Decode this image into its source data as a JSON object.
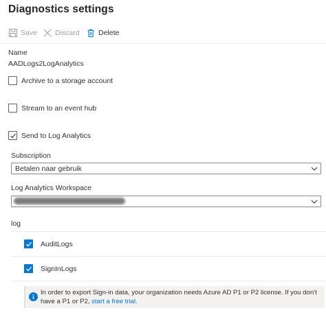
{
  "header": {
    "title": "Diagnostics settings"
  },
  "toolbar": {
    "save_label": "Save",
    "discard_label": "Discard",
    "delete_label": "Delete"
  },
  "name_section": {
    "label": "Name",
    "value": "AADLogs2LogAnalytics"
  },
  "destinations": {
    "archive_label": "Archive to a storage account",
    "archive_checked": false,
    "stream_label": "Stream to an event hub",
    "stream_checked": false,
    "log_analytics_label": "Send to Log Analytics",
    "log_analytics_checked": true
  },
  "subscription": {
    "label": "Subscription",
    "selected": "Betalen naar gebruik"
  },
  "workspace": {
    "label": "Log Analytics Workspace"
  },
  "log": {
    "heading": "log",
    "items": [
      {
        "label": "AuditLogs",
        "checked": true
      },
      {
        "label": "SignInLogs",
        "checked": true
      }
    ]
  },
  "info": {
    "text": "In order to export Sign-in data, your organization needs Azure AD P1 or P2 license. If you don't have a P1 or P2, ",
    "link_text": "start a free trial."
  },
  "icons": {
    "save": "save-icon",
    "discard": "close-icon",
    "delete": "trash-icon",
    "info": "info-icon",
    "chevron": "chevron-down-icon",
    "checkmark": "checkmark-icon"
  },
  "colors": {
    "accent": "#0078d4",
    "disabled_text": "#a19f9d",
    "info_background": "#f3f2f1"
  }
}
